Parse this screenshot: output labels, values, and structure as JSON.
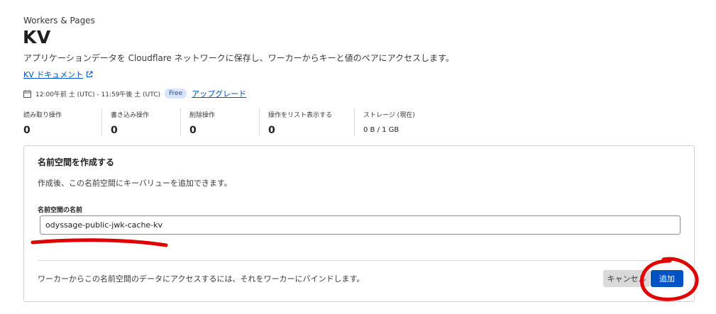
{
  "header": {
    "breadcrumb": "Workers & Pages",
    "title": "KV",
    "description": "アプリケーションデータを Cloudflare ネットワークに保存し、ワーカーからキーと値のペアにアクセスします。",
    "doc_link": "KV ドキュメント",
    "doc_link_icon": "external-link-icon"
  },
  "usage": {
    "calendar_icon": "calendar-icon",
    "period": "12:00午前 土 (UTC) - 11:59午後 土 (UTC)",
    "plan_badge": "Free",
    "upgrade_link": "アップグレード"
  },
  "stats": [
    {
      "label": "読み取り操作",
      "value": "0"
    },
    {
      "label": "書き込み操作",
      "value": "0"
    },
    {
      "label": "削除操作",
      "value": "0"
    },
    {
      "label": "操作をリスト表示する",
      "value": "0"
    },
    {
      "label": "ストレージ (現在)",
      "value": "0 B / 1 GB"
    }
  ],
  "create_namespace": {
    "title": "名前空間を作成する",
    "description": "作成後、この名前空間にキーバリューを追加できます。",
    "field_label": "名前空間の名前",
    "field_value": "odyssage-public-jwk-cache-kv",
    "footer_text": "ワーカーからこの名前空間のデータにアクセスするには、それをワーカーにバインドします。",
    "cancel_label": "キャンセル",
    "add_label": "追加"
  },
  "colors": {
    "link": "#0051c3",
    "primary_button": "#0051c3",
    "annotation_red": "#e00000",
    "badge_bg": "#d7e4fb"
  }
}
